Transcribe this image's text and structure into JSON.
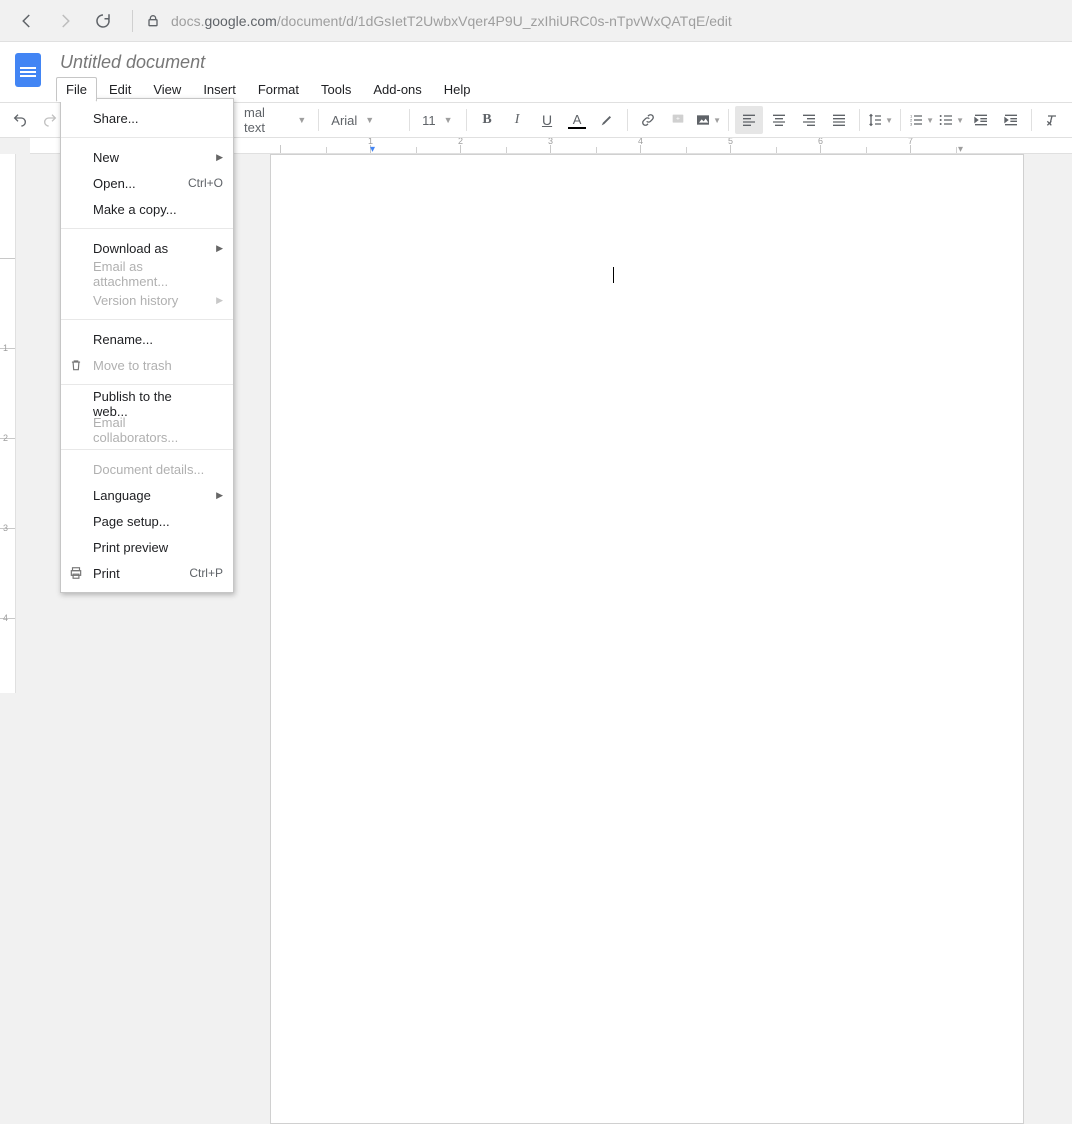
{
  "browser": {
    "url_prefix": "docs.",
    "url_domain": "google.com",
    "url_path": "/document/d/1dGsIetT2UwbxVqer4P9U_zxIhiURC0s-nTpvWxQATqE/edit"
  },
  "document": {
    "title": "Untitled document"
  },
  "menubar": [
    "File",
    "Edit",
    "View",
    "Insert",
    "Format",
    "Tools",
    "Add-ons",
    "Help"
  ],
  "toolbar": {
    "styles_label": "mal text",
    "font_label": "Arial",
    "font_size": "11"
  },
  "file_menu": {
    "groups": [
      [
        {
          "label": "Share...",
          "enabled": true
        }
      ],
      [
        {
          "label": "New",
          "enabled": true,
          "submenu": true
        },
        {
          "label": "Open...",
          "enabled": true,
          "shortcut": "Ctrl+O"
        },
        {
          "label": "Make a copy...",
          "enabled": true
        }
      ],
      [
        {
          "label": "Download as",
          "enabled": true,
          "submenu": true
        },
        {
          "label": "Email as attachment...",
          "enabled": false
        },
        {
          "label": "Version history",
          "enabled": false,
          "submenu": true
        }
      ],
      [
        {
          "label": "Rename...",
          "enabled": true
        },
        {
          "label": "Move to trash",
          "enabled": false,
          "icon": "trash"
        }
      ],
      [
        {
          "label": "Publish to the web...",
          "enabled": true
        },
        {
          "label": "Email collaborators...",
          "enabled": false
        }
      ],
      [
        {
          "label": "Document details...",
          "enabled": false
        },
        {
          "label": "Language",
          "enabled": true,
          "submenu": true
        },
        {
          "label": "Page setup...",
          "enabled": true
        },
        {
          "label": "Print preview",
          "enabled": true
        },
        {
          "label": "Print",
          "enabled": true,
          "shortcut": "Ctrl+P",
          "icon": "print"
        }
      ]
    ]
  },
  "hruler": [
    "",
    "1",
    "2",
    "3",
    "4",
    "5",
    "6",
    "7"
  ],
  "vruler": [
    "",
    "1",
    "2",
    "3",
    "4"
  ]
}
